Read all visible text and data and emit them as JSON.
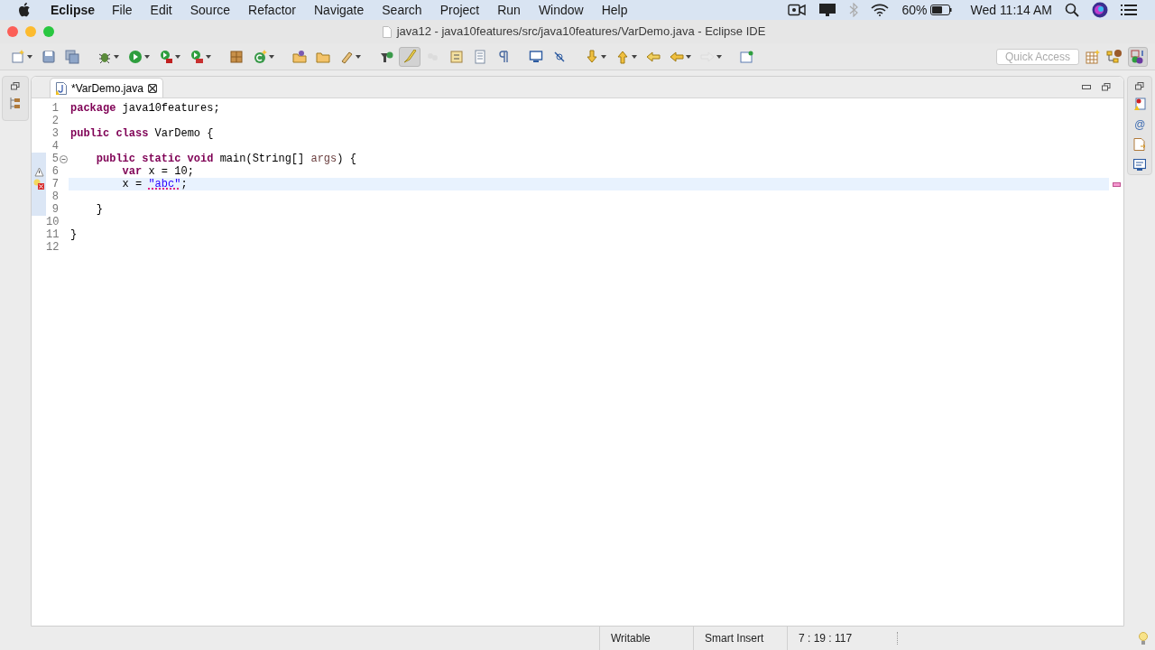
{
  "menu_bar": {
    "app": "Eclipse",
    "menus": [
      "File",
      "Edit",
      "Source",
      "Refactor",
      "Navigate",
      "Search",
      "Project",
      "Run",
      "Window",
      "Help"
    ],
    "battery": "60%",
    "clock": "Wed 11:14 AM"
  },
  "window": {
    "title": "java12 - java10features/src/java10features/VarDemo.java - Eclipse IDE"
  },
  "toolbar": [
    {
      "kind": "new",
      "pressed": false,
      "disabled": false
    },
    {
      "kind": "save",
      "pressed": false,
      "disabled": false
    },
    {
      "kind": "save-all",
      "pressed": false,
      "disabled": false
    },
    {
      "kind": "debug",
      "pressed": false,
      "disabled": false
    },
    {
      "kind": "run",
      "pressed": false,
      "disabled": false
    },
    {
      "kind": "coverage",
      "pressed": false,
      "disabled": false
    },
    {
      "kind": "external",
      "pressed": false,
      "disabled": false
    },
    {
      "kind": "package",
      "pressed": false,
      "disabled": false
    },
    {
      "kind": "class",
      "pressed": false,
      "disabled": false
    },
    {
      "kind": "open-type",
      "pressed": false,
      "disabled": false
    },
    {
      "kind": "folder",
      "pressed": false,
      "disabled": false
    },
    {
      "kind": "pen",
      "pressed": false,
      "disabled": false
    },
    {
      "kind": "task",
      "pressed": false,
      "disabled": false
    },
    {
      "kind": "highlight",
      "pressed": true,
      "disabled": false
    },
    {
      "kind": "dots",
      "pressed": false,
      "disabled": true
    },
    {
      "kind": "block",
      "pressed": false,
      "disabled": false
    },
    {
      "kind": "doc",
      "pressed": false,
      "disabled": false
    },
    {
      "kind": "pilcrow",
      "pressed": false,
      "disabled": false
    },
    {
      "kind": "monitor",
      "pressed": false,
      "disabled": false
    },
    {
      "kind": "link",
      "pressed": false,
      "disabled": false
    },
    {
      "kind": "down",
      "pressed": false,
      "disabled": false
    },
    {
      "kind": "up",
      "pressed": false,
      "disabled": false
    },
    {
      "kind": "back-edit",
      "pressed": false,
      "disabled": false
    },
    {
      "kind": "back",
      "pressed": false,
      "disabled": false
    },
    {
      "kind": "forward",
      "pressed": false,
      "disabled": true
    },
    {
      "kind": "pin",
      "pressed": false,
      "disabled": false
    }
  ],
  "quick_access": {
    "placeholder": "Quick Access"
  },
  "tabs": [
    {
      "label": "*VarDemo.java",
      "selected": true
    }
  ],
  "right_trim": {
    "javadoc_glyph": "@"
  },
  "code": [
    {
      "number": "1",
      "warning": false,
      "error": false,
      "fold": false,
      "scope": false,
      "current": false,
      "tokens": [
        {
          "kind": "keyword",
          "text": "package"
        },
        {
          "kind": "plain",
          "text": " java10features;"
        }
      ]
    },
    {
      "number": "2",
      "warning": false,
      "error": false,
      "fold": false,
      "scope": false,
      "current": false
    },
    {
      "number": "3",
      "warning": false,
      "error": false,
      "fold": false,
      "scope": false,
      "current": false,
      "tokens": [
        {
          "kind": "keyword",
          "text": "public class"
        },
        {
          "kind": "plain",
          "text": " VarDemo {"
        }
      ]
    },
    {
      "number": "4",
      "warning": false,
      "error": false,
      "fold": false,
      "scope": false,
      "current": false
    },
    {
      "number": "5",
      "warning": false,
      "error": false,
      "fold": true,
      "scope": true,
      "current": false,
      "tokens": [
        {
          "kind": "keyword",
          "text": "    public static void"
        },
        {
          "kind": "plain",
          "text": " main(String[] "
        },
        {
          "kind": "param",
          "text": "args"
        },
        {
          "kind": "plain",
          "text": ") {"
        }
      ]
    },
    {
      "number": "6",
      "warning": true,
      "error": false,
      "fold": false,
      "scope": true,
      "current": false,
      "tokens": [
        {
          "kind": "keyword",
          "text": "        var"
        },
        {
          "kind": "plain",
          "text": " x = 10;"
        }
      ]
    },
    {
      "number": "7",
      "warning": false,
      "error": true,
      "fold": false,
      "scope": true,
      "current": true,
      "tokens": [
        {
          "kind": "plain",
          "text": "        x = "
        },
        {
          "kind": "error",
          "text": "\"abc\""
        },
        {
          "kind": "plain",
          "text": ";"
        }
      ]
    },
    {
      "number": "8",
      "warning": false,
      "error": false,
      "fold": false,
      "scope": true,
      "current": false
    },
    {
      "number": "9",
      "warning": false,
      "error": false,
      "fold": false,
      "scope": true,
      "current": false,
      "tokens": [
        {
          "kind": "plain",
          "text": "    }"
        }
      ]
    },
    {
      "number": "10",
      "warning": false,
      "error": false,
      "fold": false,
      "scope": false,
      "current": false
    },
    {
      "number": "11",
      "warning": false,
      "error": false,
      "fold": false,
      "scope": false,
      "current": false,
      "tokens": [
        {
          "kind": "plain",
          "text": "}"
        }
      ]
    },
    {
      "number": "12",
      "warning": false,
      "error": false,
      "fold": false,
      "scope": false,
      "current": false
    }
  ],
  "status_bar": [
    "Writable",
    "Smart Insert",
    "7 : 19 : 117"
  ]
}
